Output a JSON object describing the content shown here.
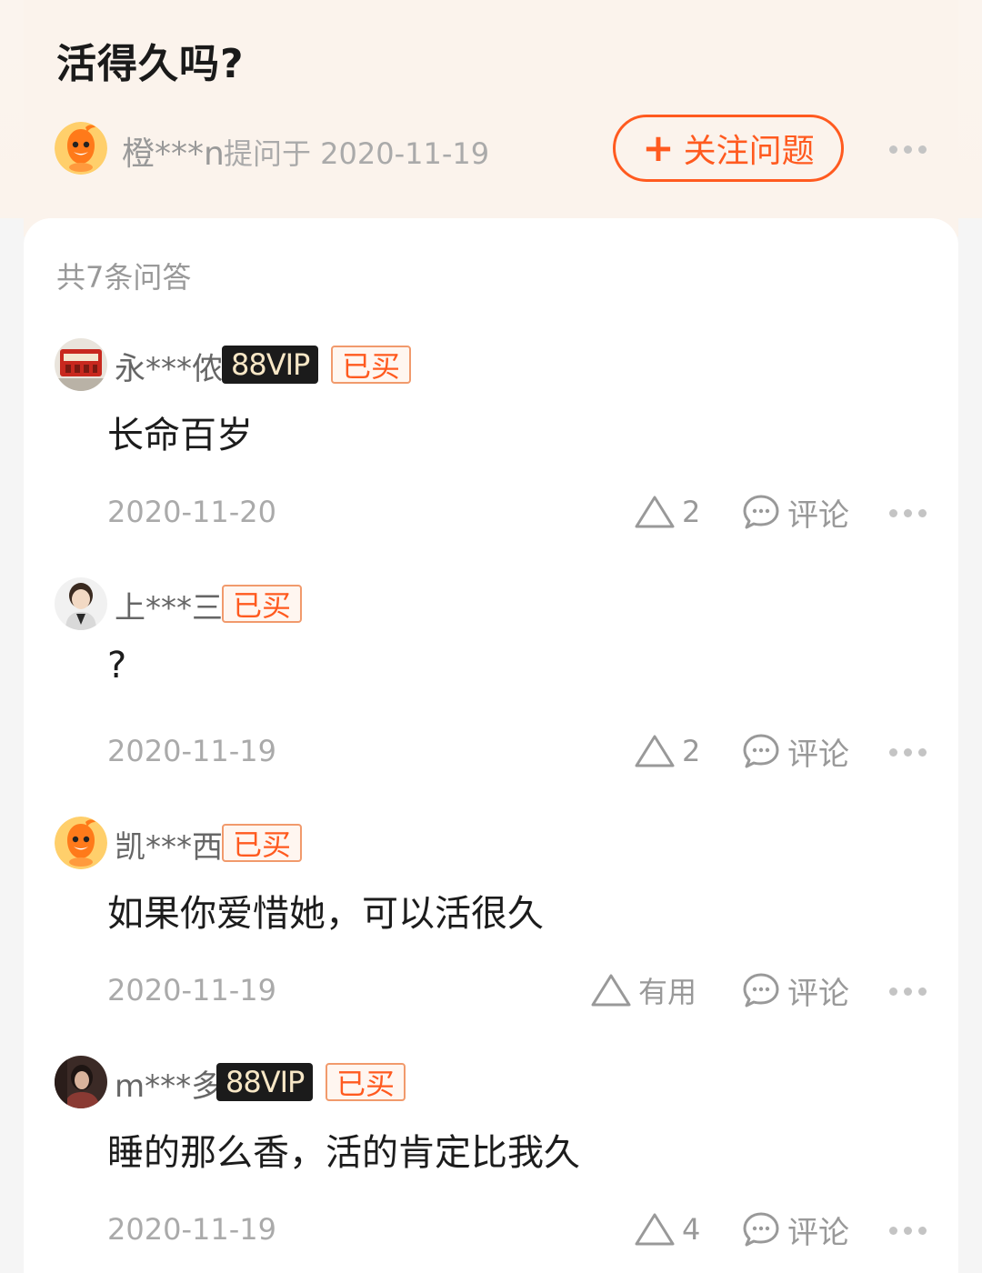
{
  "question": {
    "title": "活得久吗?",
    "asker": "橙***n",
    "asked_label": "提问于 2020-11-19",
    "follow_plus": "+",
    "follow_label": "关注问题"
  },
  "count_label": "共7条问答",
  "answers": [
    {
      "name": "永***侬",
      "vip": "88VIP",
      "bought": "已买",
      "text": "长命百岁",
      "date": "2020-11-20",
      "like": "2",
      "comment": "评论"
    },
    {
      "name": "上***三",
      "bought": "已买",
      "text": "?",
      "date": "2020-11-19",
      "like": "2",
      "comment": "评论"
    },
    {
      "name": "凯***西",
      "bought": "已买",
      "text": "如果你爱惜她，可以活很久",
      "date": "2020-11-19",
      "like": "有用",
      "comment": "评论"
    },
    {
      "name": "m***多",
      "vip": "88VIP",
      "bought": "已买",
      "text": "睡的那么香，活的肯定比我久",
      "date": "2020-11-19",
      "like": "4",
      "comment": "评论"
    }
  ],
  "colors": {
    "accent": "#ff5a1f",
    "vip_bg": "#1b1b1b",
    "vip_text": "#f7e7c6"
  }
}
